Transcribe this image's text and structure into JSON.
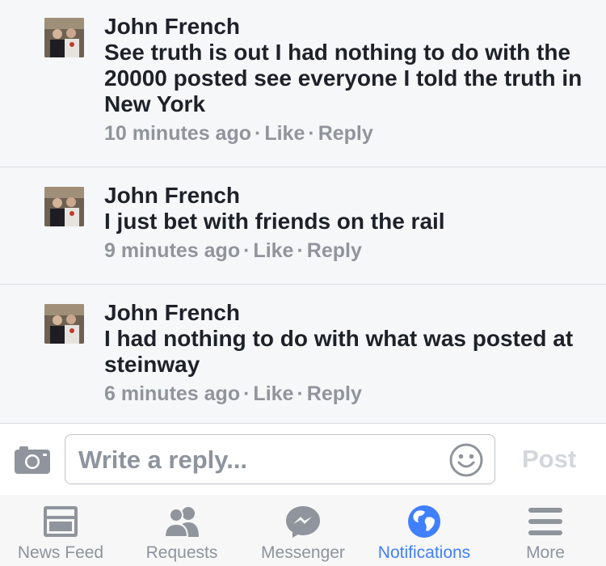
{
  "comments": [
    {
      "author": "John French",
      "text": "See truth is out I had nothing to do with the 20000 posted see everyone I told the truth in New York",
      "time": "10 minutes ago",
      "like": "Like",
      "reply": "Reply"
    },
    {
      "author": "John French",
      "text": "I just bet with friends on the rail",
      "time": "9 minutes ago",
      "like": "Like",
      "reply": "Reply"
    },
    {
      "author": "John French",
      "text": "I had nothing to do with what was posted at steinway",
      "time": "6 minutes ago",
      "like": "Like",
      "reply": "Reply"
    }
  ],
  "composer": {
    "placeholder": "Write a reply...",
    "post_label": "Post"
  },
  "tabs": [
    {
      "label": "News Feed",
      "icon": "news-feed-icon",
      "active": false
    },
    {
      "label": "Requests",
      "icon": "friend-requests-icon",
      "active": false
    },
    {
      "label": "Messenger",
      "icon": "messenger-icon",
      "active": false
    },
    {
      "label": "Notifications",
      "icon": "globe-icon",
      "active": true
    },
    {
      "label": "More",
      "icon": "menu-icon",
      "active": false
    }
  ],
  "colors": {
    "accent": "#4080ff",
    "muted": "#90949c",
    "background": "#f6f7f9"
  },
  "separator": "·"
}
